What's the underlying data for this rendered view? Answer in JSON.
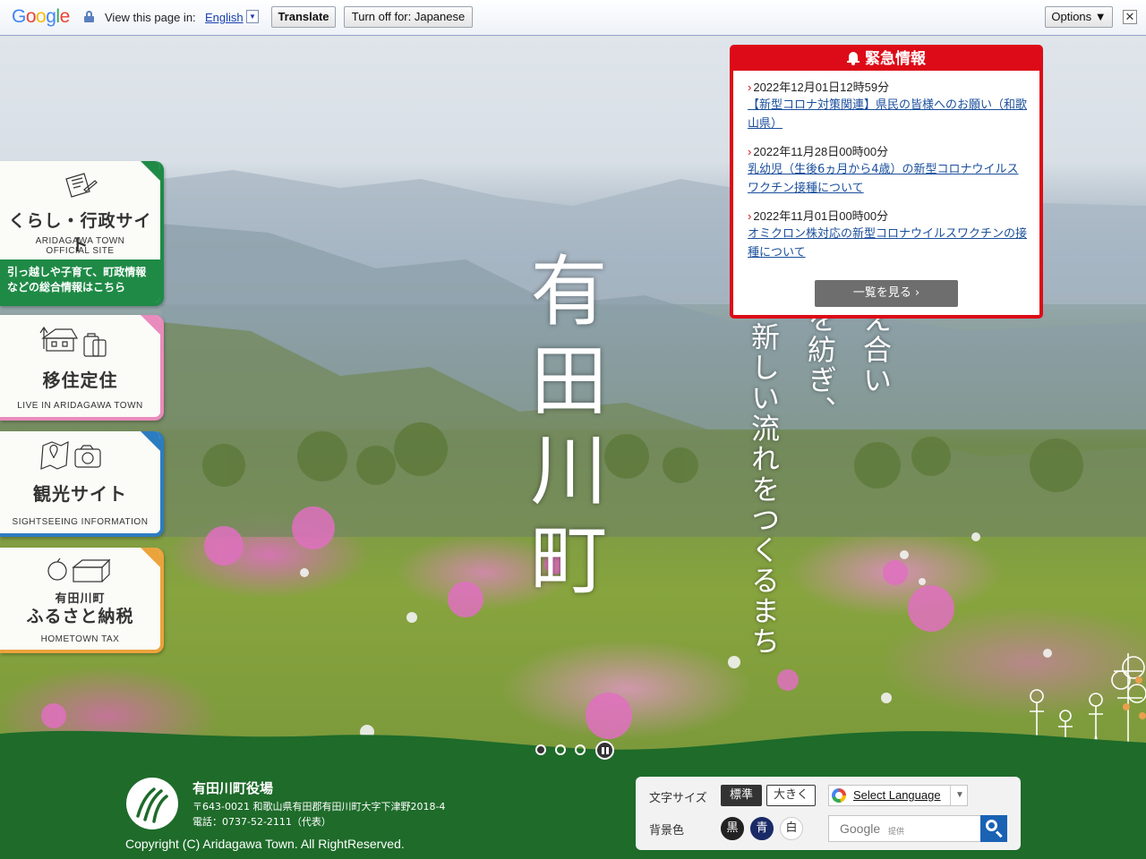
{
  "translate_bar": {
    "logo": "Google",
    "view_label": "View this page in:",
    "language": "English",
    "translate_button": "Translate",
    "turn_off_button": "Turn off for: Japanese",
    "options_button": "Options ▼",
    "close": "✕"
  },
  "side_nav": {
    "kurashi": {
      "title": "くらし・行政サイト",
      "sub1": "ARIDAGAWA TOWN",
      "sub2": "OFFICIAL SITE",
      "desc1": "引っ越しや子育て、町政情報",
      "desc2": "などの総合情報はこちら"
    },
    "iju": {
      "title": "移住定住",
      "sub": "LIVE IN ARIDAGAWA TOWN"
    },
    "kanko": {
      "title": "観光サイト",
      "sub": "SIGHTSEEING INFORMATION"
    },
    "furusato": {
      "title_small": "有田川町",
      "title": "ふるさと納税",
      "sub": "HOMETOWN TAX"
    }
  },
  "hero": {
    "title": "有田川町",
    "copy_lines": [
      "新しい流れをつくるまち",
      "を紡ぎ、",
      "え合い"
    ]
  },
  "emergency": {
    "header": "緊急情報",
    "items": [
      {
        "date": "2022年12月01日12時59分",
        "link": "【新型コロナ対策関連】県民の皆様へのお願い（和歌山県）"
      },
      {
        "date": "2022年11月28日00時00分",
        "link": "乳幼児（生後6ヵ月から4歳）の新型コロナウイルスワクチン接種について"
      },
      {
        "date": "2022年11月01日00時00分",
        "link": "オミクロン株対応の新型コロナウイルスワクチンの接種について"
      }
    ],
    "more_button": "一覧を見る ›"
  },
  "footer": {
    "town_office": "有田川町役場",
    "address": "〒643-0021 和歌山県有田郡有田川町大字下津野2018-4",
    "phone": "電話：0737-52-2111（代表）",
    "copyright": "Copyright (C) Aridagawa Town. All RightReserved."
  },
  "tools": {
    "font_size_label": "文字サイズ",
    "font_standard": "標準",
    "font_large": "大きく",
    "bg_label": "背景色",
    "bg_black": "黒",
    "bg_blue": "青",
    "bg_white": "白",
    "select_language": "Select Language",
    "select_arrow": "▼",
    "search_brand": "Google",
    "search_provided": "提供"
  },
  "colors": {
    "emergency_red": "#dd0b17",
    "footer_green": "#1e6b2a",
    "link_blue": "#1b4f9c"
  }
}
